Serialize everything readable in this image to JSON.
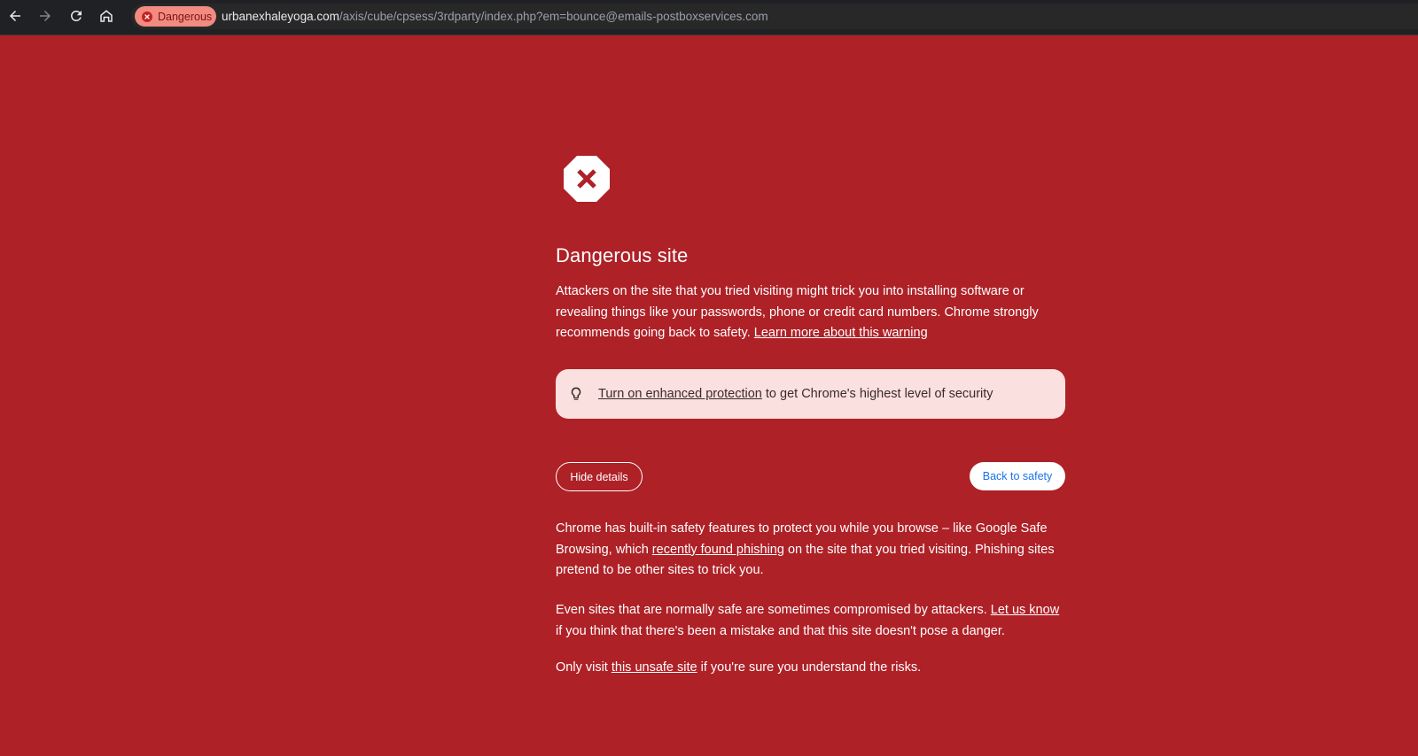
{
  "browser": {
    "security_chip_label": "Dangerous",
    "url_host": "urbanexhaleyoga.com",
    "url_path": "/axis/cube/cpsess/3rdparty/index.php?em=bounce@emails-postboxservices.com",
    "icons": [
      "back-arrow-icon",
      "forward-arrow-icon",
      "reload-icon",
      "home-icon",
      "danger-icon"
    ]
  },
  "interstitial": {
    "icon": "stop-sign-x-icon",
    "title": "Dangerous site",
    "intro_text": "Attackers on the site that you tried visiting might trick you into installing software or revealing things like your passwords, phone or credit card numbers. Chrome strongly recommends going back to safety.",
    "learn_more_link": "Learn more about this warning",
    "tip": {
      "icon": "lightbulb-icon",
      "link": "Turn on enhanced protection",
      "text": "to get Chrome's highest level of security"
    },
    "hide_details_button": "Hide details",
    "back_to_safety_button": "Back to safety",
    "details": {
      "p1_before": "Chrome has built-in safety features to protect you while you browse – like Google Safe Browsing, which",
      "p1_link": "recently found phishing",
      "p1_after": "on the site that you tried visiting. Phishing sites pretend to be other sites to trick you.",
      "p2_before": "Even sites that are normally safe are sometimes compromised by attackers.",
      "p2_link": "Let us know",
      "p2_after": "if you think that there's been a mistake and that this site doesn't pose a danger.",
      "p3_before": "Only visit",
      "p3_link": "this unsafe site",
      "p3_after": "if you're sure you understand the risks."
    }
  },
  "colors": {
    "background": "#ae2127",
    "toolbar": "#202124",
    "chip": "#f28b82",
    "tip_background": "#fae0df",
    "link_blue": "#1a73e8"
  }
}
